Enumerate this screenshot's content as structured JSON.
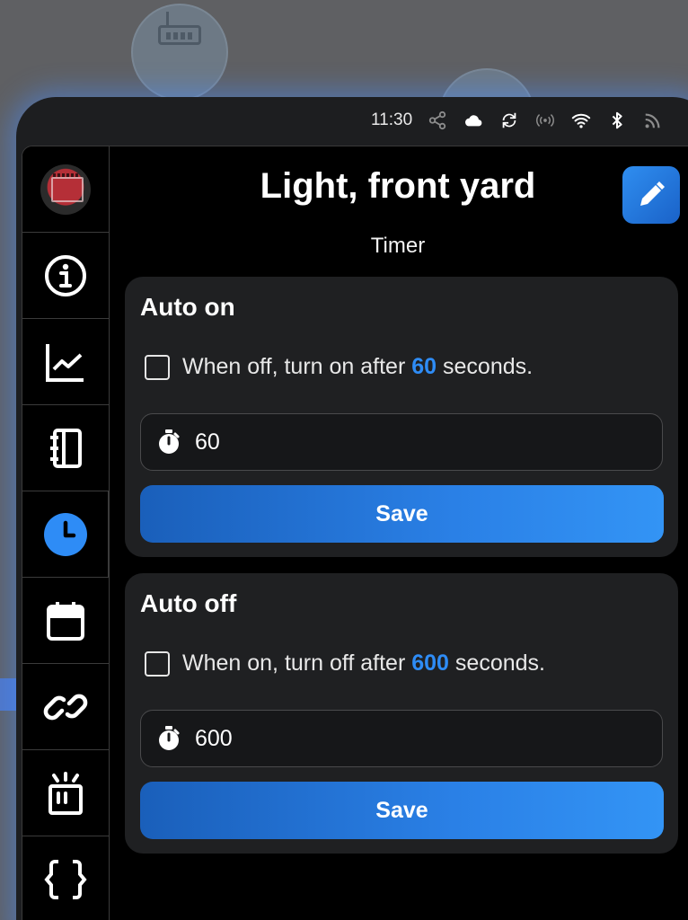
{
  "status_bar": {
    "time": "11:30",
    "icons": [
      "share-icon",
      "cloud-icon",
      "sync-icon",
      "broadcast-icon",
      "wifi-icon",
      "bluetooth-icon",
      "rss-icon"
    ]
  },
  "sidebar": {
    "items": [
      {
        "name": "device-thumbnail"
      },
      {
        "name": "info-icon"
      },
      {
        "name": "chart-icon"
      },
      {
        "name": "notebook-icon"
      },
      {
        "name": "clock-icon",
        "active": true
      },
      {
        "name": "calendar-icon"
      },
      {
        "name": "link-icon"
      },
      {
        "name": "notification-icon"
      },
      {
        "name": "braces-icon"
      }
    ]
  },
  "header": {
    "title": "Light, front yard",
    "subtitle": "Timer"
  },
  "auto_on": {
    "title": "Auto on",
    "text_before": "When off, turn on after",
    "seconds": "60",
    "text_after": "seconds.",
    "input_value": "60",
    "save_label": "Save"
  },
  "auto_off": {
    "title": "Auto off",
    "text_before": "When on, turn off after",
    "seconds": "600",
    "text_after": "seconds.",
    "input_value": "600",
    "save_label": "Save"
  },
  "colors": {
    "accent": "#2e8cf6",
    "panel": "#1f2022",
    "background": "#000000"
  }
}
